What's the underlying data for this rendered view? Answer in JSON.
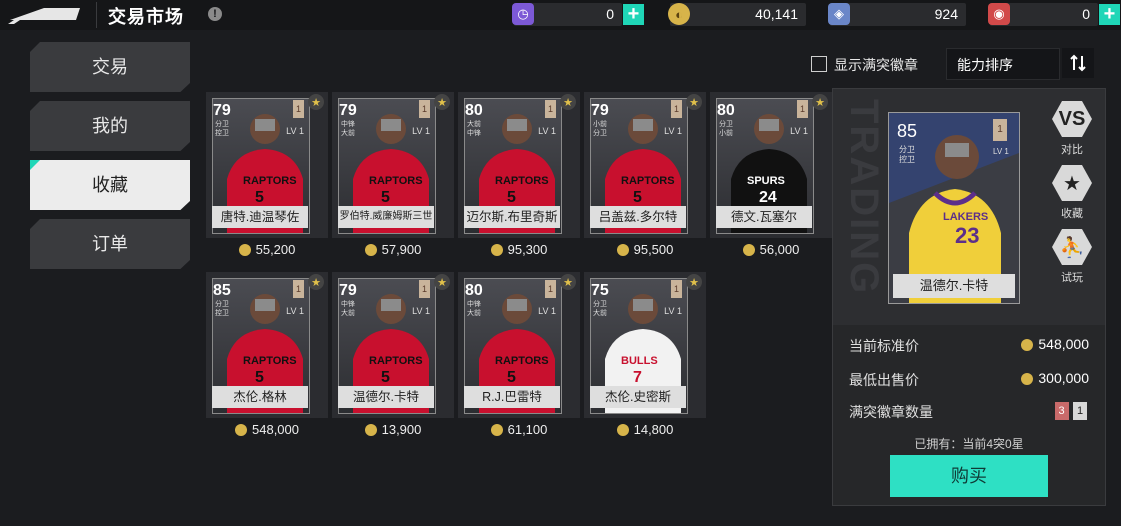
{
  "header": {
    "title": "交易市场",
    "info_glyph": "!",
    "currencies": [
      {
        "icon": "ticket-icon",
        "value": "0",
        "plus": true,
        "color": "#7c59d6"
      },
      {
        "icon": "gold-coin-icon",
        "value": "40,141",
        "plus": false,
        "color": "#d7b44a"
      },
      {
        "icon": "diamond-icon",
        "value": "924",
        "plus": false,
        "color": "#6a86c8"
      },
      {
        "icon": "red-gem-icon",
        "value": "0",
        "plus": true,
        "color": "#d24a4a"
      }
    ]
  },
  "sidebar": {
    "items": [
      {
        "label": "交易",
        "active": false
      },
      {
        "label": "我的",
        "active": false
      },
      {
        "label": "收藏",
        "active": true
      },
      {
        "label": "订单",
        "active": false
      }
    ]
  },
  "toolbar": {
    "show_full_badge_label": "显示满突徽章",
    "sort_label": "能力排序",
    "sort_icon": "sort-icon"
  },
  "cards": [
    {
      "rating": "79",
      "pos": "分卫\n控卫",
      "lv": "LV 1",
      "badge": "1",
      "name": "唐特.迪温琴佐",
      "price": "55,200",
      "jersey": "raptors",
      "num": "5"
    },
    {
      "rating": "79",
      "pos": "中锋\n大前",
      "lv": "LV 1",
      "badge": "1",
      "name": "罗伯特.威廉姆斯三世",
      "price": "57,900",
      "jersey": "raptors",
      "num": "5"
    },
    {
      "rating": "80",
      "pos": "大前\n中锋",
      "lv": "LV 1",
      "badge": "1",
      "name": "迈尔斯.布里奇斯",
      "price": "95,300",
      "jersey": "raptors",
      "num": "5"
    },
    {
      "rating": "79",
      "pos": "小前\n分卫",
      "lv": "LV 1",
      "badge": "1",
      "name": "吕盖兹.多尔特",
      "price": "95,500",
      "jersey": "raptors",
      "num": "5"
    },
    {
      "rating": "80",
      "pos": "分卫\n小前",
      "lv": "LV 1",
      "badge": "1",
      "name": "德文.瓦塞尔",
      "price": "56,000",
      "jersey": "spurs",
      "num": "24"
    },
    {
      "rating": "85",
      "pos": "分卫\n控卫",
      "lv": "LV 1",
      "badge": "1",
      "name": "杰伦.格林",
      "price": "548,000",
      "jersey": "raptors",
      "num": "5"
    },
    {
      "rating": "79",
      "pos": "中锋\n大前",
      "lv": "LV 1",
      "badge": "1",
      "name": "温德尔.卡特",
      "price": "13,900",
      "jersey": "raptors",
      "num": "5"
    },
    {
      "rating": "80",
      "pos": "中锋\n大前",
      "lv": "LV 1",
      "badge": "1",
      "name": "R.J.巴雷特",
      "price": "61,100",
      "jersey": "raptors",
      "num": "5"
    },
    {
      "rating": "75",
      "pos": "分卫\n大前",
      "lv": "LV 1",
      "badge": "1",
      "name": "杰伦.史密斯",
      "price": "14,800",
      "jersey": "bulls",
      "num": "7"
    }
  ],
  "detail": {
    "bg_text": "TRADING",
    "rating": "85",
    "pos": "分卫\n控卫",
    "lv": "LV 1",
    "badge": "1",
    "name": "温德尔.卡特",
    "jersey_team": "LAKERS",
    "jersey_num": "23",
    "actions": [
      {
        "icon": "vs-icon",
        "glyph": "VS",
        "label": "对比"
      },
      {
        "icon": "star-icon",
        "glyph": "★",
        "label": "收藏"
      },
      {
        "icon": "try-play-icon",
        "glyph": "⛹",
        "label": "试玩"
      }
    ],
    "stats": [
      {
        "label": "当前标准价",
        "value": "548,000"
      },
      {
        "label": "最低出售价",
        "value": "300,000"
      }
    ],
    "full_badge_label": "满突徽章数量",
    "full_badge_values": [
      "3",
      "1"
    ],
    "owned": "已拥有：当前4突0星",
    "buy_label": "购买"
  }
}
